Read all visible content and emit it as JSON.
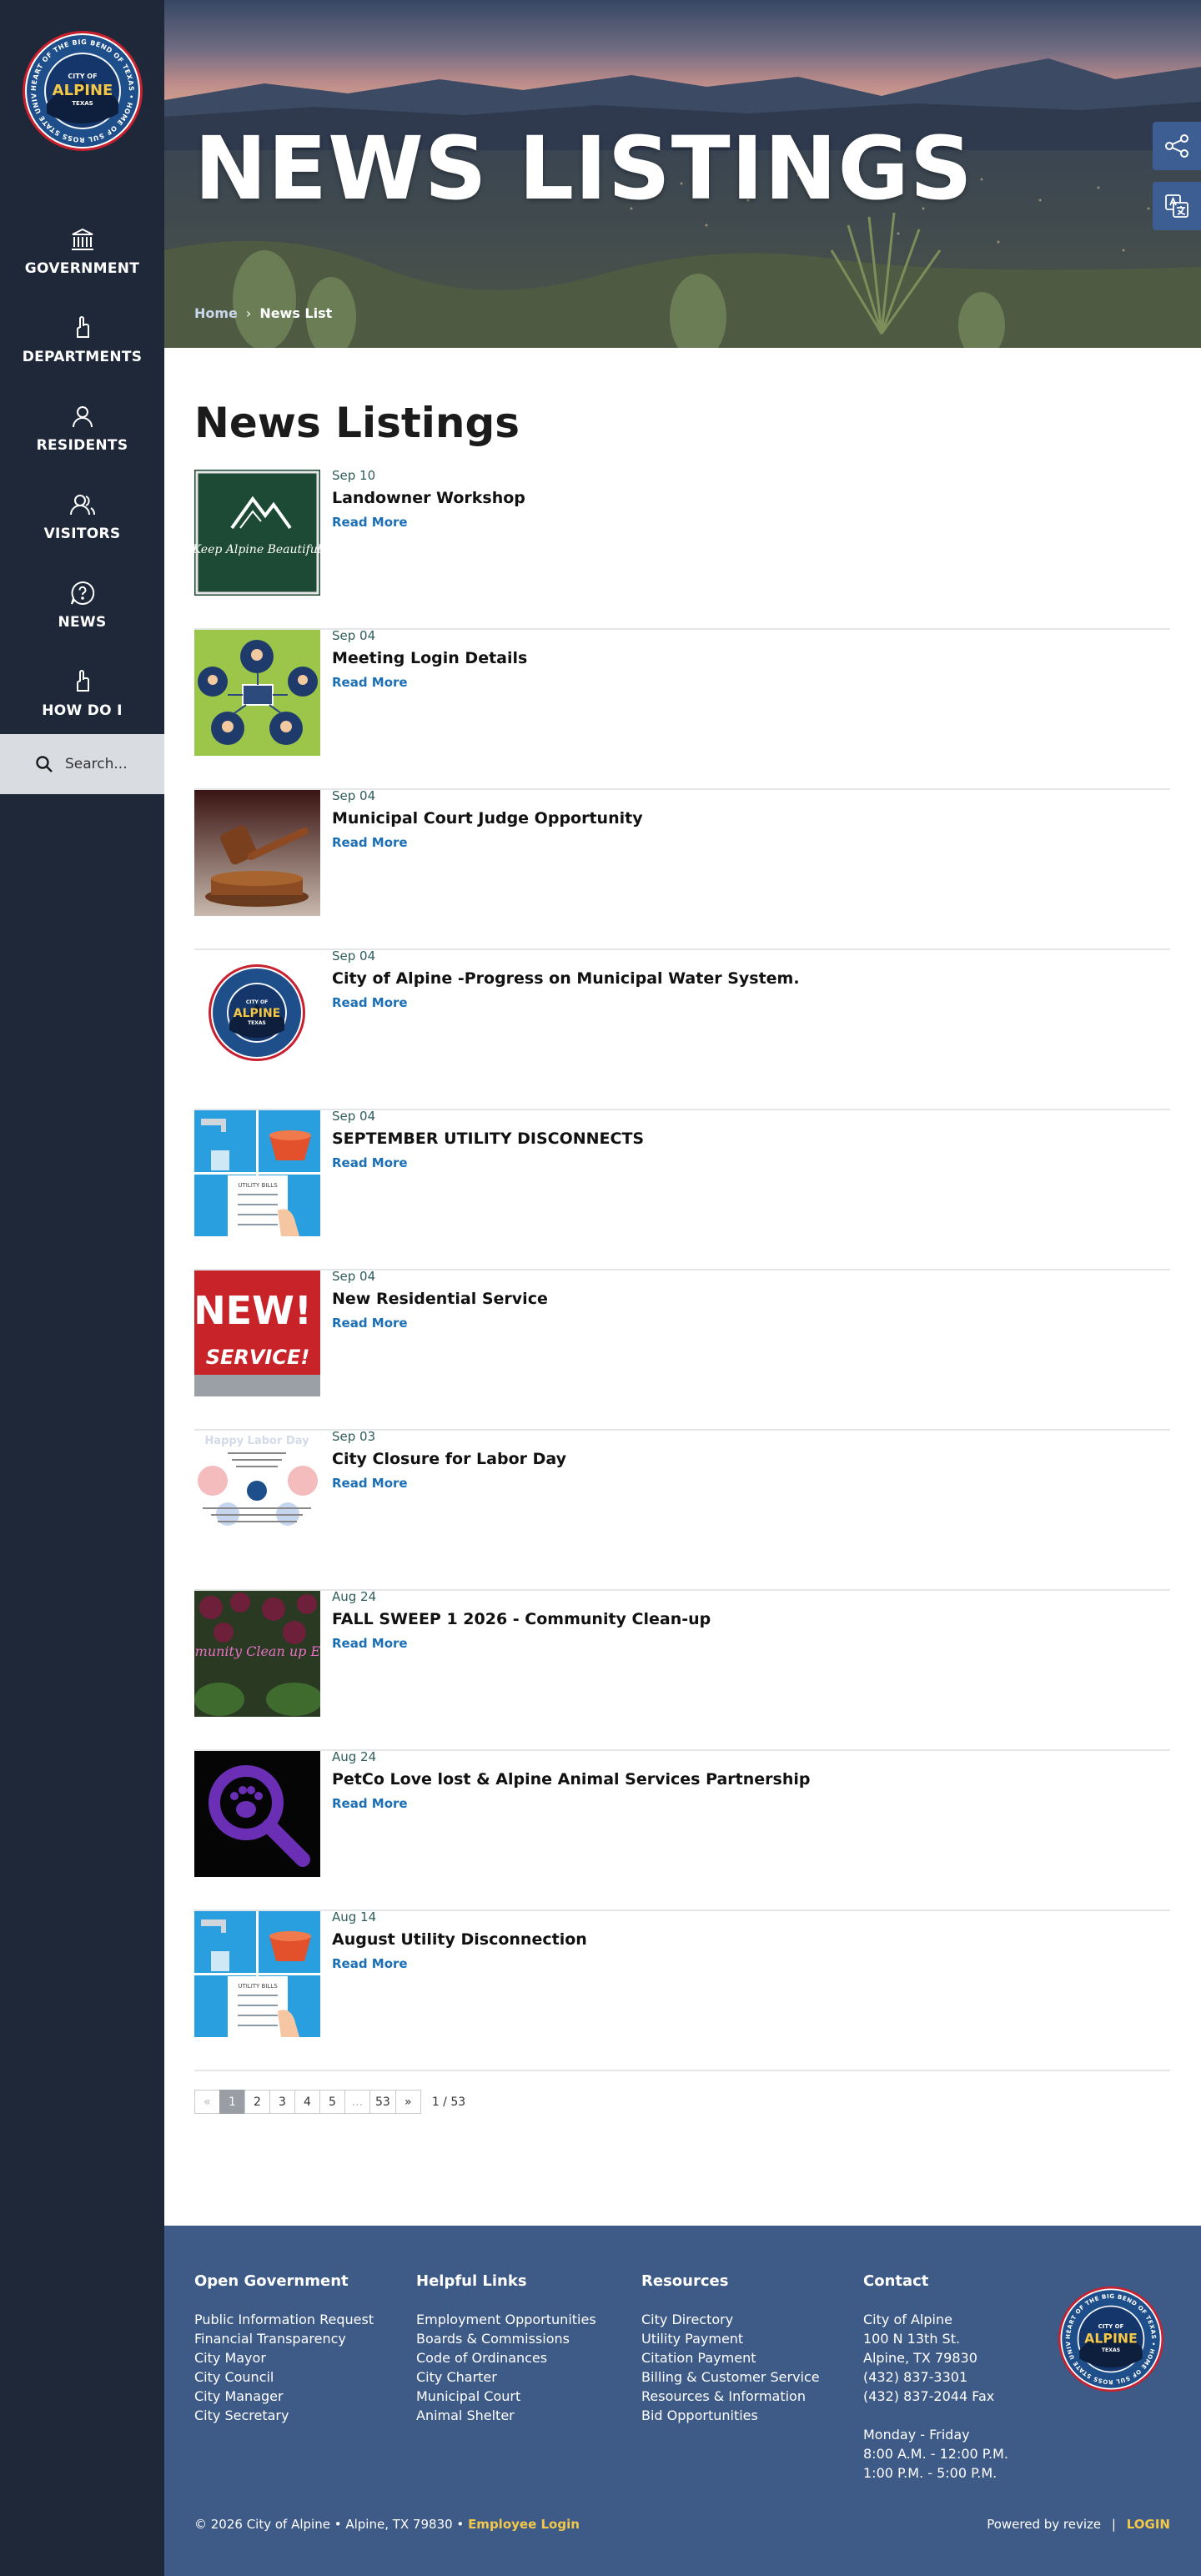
{
  "sidebar": {
    "logo": {
      "ring_text": "HEART OF THE BIG BEND OF TEXAS • HOME OF SUL ROSS STATE UNIVERSITY • BREWSTER COUNTY SEAT",
      "city_of": "CITY OF",
      "name": "ALPINE",
      "state": "TEXAS"
    },
    "items": [
      {
        "label": "GOVERNMENT",
        "icon": "capitol-building-icon"
      },
      {
        "label": "DEPARTMENTS",
        "icon": "hand-pointer-icon"
      },
      {
        "label": "RESIDENTS",
        "icon": "person-icon"
      },
      {
        "label": "VISITORS",
        "icon": "people-icon"
      },
      {
        "label": "NEWS",
        "icon": "speech-bubble-question-icon"
      },
      {
        "label": "HOW DO I",
        "icon": "hand-pointer-icon"
      }
    ],
    "search": {
      "placeholder": "Search...",
      "icon": "search-icon"
    }
  },
  "hero": {
    "title": "NEWS LISTINGS",
    "breadcrumb": {
      "home": "Home",
      "separator": "›",
      "current": "News List"
    },
    "float_buttons": [
      {
        "icon": "share-icon"
      },
      {
        "icon": "translate-icon"
      }
    ]
  },
  "main": {
    "heading": "News Listings",
    "read_more_label": "Read More",
    "items": [
      {
        "date": "Sep 10",
        "title": "Landowner Workshop"
      },
      {
        "date": "Sep 04",
        "title": "Meeting Login Details"
      },
      {
        "date": "Sep 04",
        "title": "Municipal Court Judge Opportunity"
      },
      {
        "date": "Sep 04",
        "title": "City of Alpine -Progress on Municipal Water System."
      },
      {
        "date": "Sep 04",
        "title": "SEPTEMBER UTILITY DISCONNECTS"
      },
      {
        "date": "Sep 04",
        "title": "New Residential Service"
      },
      {
        "date": "Sep 03",
        "title": "City Closure for Labor Day"
      },
      {
        "date": "Aug 24",
        "title": "FALL SWEEP 1 2026 - Community Clean-up"
      },
      {
        "date": "Aug 24",
        "title": "PetCo Love lost & Alpine Animal Services Partnership"
      },
      {
        "date": "Aug 14",
        "title": "August Utility Disconnection"
      }
    ],
    "thumb_text": {
      "workshop": "Keep Alpine Beautiful",
      "utility": "UTILITY BILLS",
      "new_top": "NEW!",
      "new_bottom": "SERVICE!",
      "labor": "Happy Labor Day",
      "cleanup": "Community Clean up Event"
    },
    "pagination": {
      "prev": "«",
      "pages": [
        "1",
        "2",
        "3",
        "4",
        "5",
        "...",
        "53"
      ],
      "next": "»",
      "current": "1",
      "count": "1 / 53"
    }
  },
  "footer": {
    "columns": [
      {
        "heading": "Open Government",
        "links": [
          "Public Information Request",
          "Financial Transparency",
          "City Mayor",
          "City Council",
          "City Manager",
          "City Secretary"
        ]
      },
      {
        "heading": "Helpful Links",
        "links": [
          "Employment Opportunities",
          "Boards & Commissions",
          "Code of Ordinances",
          "City Charter",
          "Municipal Court",
          "Animal Shelter"
        ]
      },
      {
        "heading": "Resources",
        "links": [
          "City Directory",
          "Utility Payment",
          "Citation Payment",
          "Billing & Customer Service",
          "Resources & Information",
          "Bid Opportunities"
        ]
      }
    ],
    "contact": {
      "heading": "Contact",
      "lines": [
        "City of Alpine",
        "100 N 13th St.",
        "Alpine, TX 79830",
        "(432) 837-3301",
        "(432) 837-2044 Fax"
      ],
      "hours": [
        "Monday - Friday",
        "8:00 A.M. - 12:00 P.M.",
        "1:00 P.M. - 5:00 P.M."
      ]
    },
    "copyright": "© 2026 City of Alpine • Alpine, TX 79830 •",
    "employee_login": "Employee Login",
    "powered_by": "Powered by revize",
    "divider": "|",
    "login": "LOGIN"
  },
  "colors": {
    "sidebar": "#1f2838",
    "footer": "#3e5a87",
    "link": "#1a6fb5",
    "accent": "#f2c84b"
  }
}
